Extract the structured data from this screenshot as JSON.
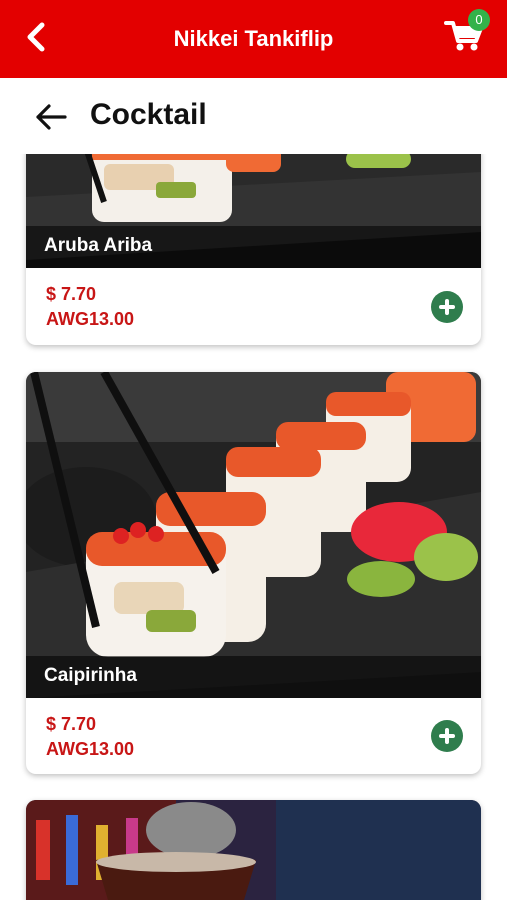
{
  "app": {
    "title": "Nikkei Tankiflip",
    "cart_count": "0",
    "accent_color": "#e30000",
    "add_button_color": "#2f7d4d",
    "icons": {
      "back": "chevron-left-icon",
      "cart": "cart-icon",
      "page_back": "arrow-left-icon",
      "add": "plus-circle-icon"
    }
  },
  "page": {
    "heading": "Cocktail"
  },
  "items": [
    {
      "name": "Aruba Ariba",
      "price_usd": "$ 7.70",
      "price_awg": "AWG13.00"
    },
    {
      "name": "Caipirinha",
      "price_usd": "$ 7.70",
      "price_awg": "AWG13.00"
    }
  ]
}
